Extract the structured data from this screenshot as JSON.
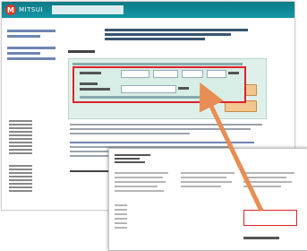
{
  "header": {
    "logo_mark": "M",
    "logo_text": "MITSUI",
    "caption": ""
  },
  "colors": {
    "header": "#0c7a86",
    "highlight": "#e0202a",
    "arrow": "#e88d55",
    "panel": "#dff0ea"
  },
  "icons": {
    "arrow": "arrow-up-left-icon"
  }
}
